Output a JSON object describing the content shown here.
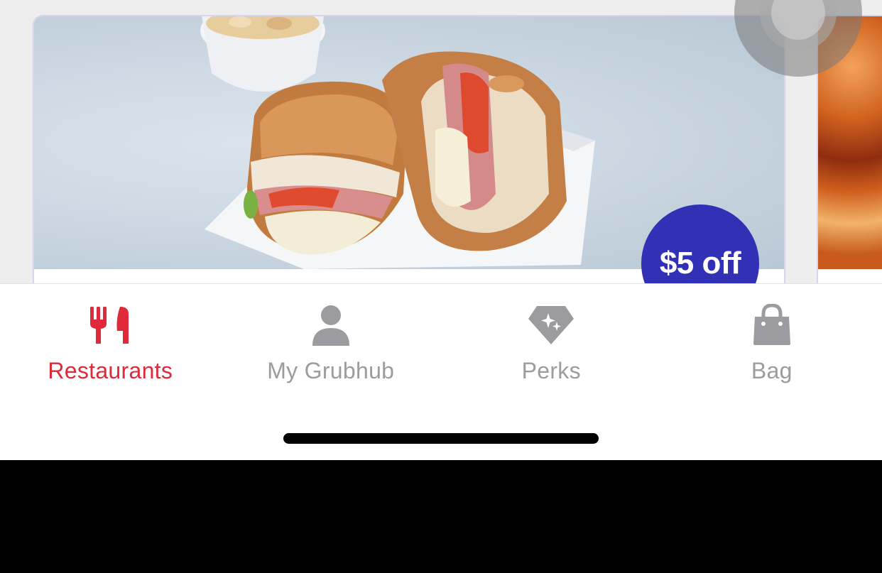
{
  "offer": {
    "badge_text": "$5 off"
  },
  "tabs": [
    {
      "label": "Restaurants",
      "icon": "fork-knife-icon",
      "active": true
    },
    {
      "label": "My Grubhub",
      "icon": "person-icon",
      "active": false
    },
    {
      "label": "Perks",
      "icon": "diamond-sparkle-icon",
      "active": false
    },
    {
      "label": "Bag",
      "icon": "shopping-bag-icon",
      "active": false
    }
  ],
  "colors": {
    "accent_red": "#e0293a",
    "inactive_gray": "#9c9b9f",
    "offer_badge": "#3230b4"
  }
}
